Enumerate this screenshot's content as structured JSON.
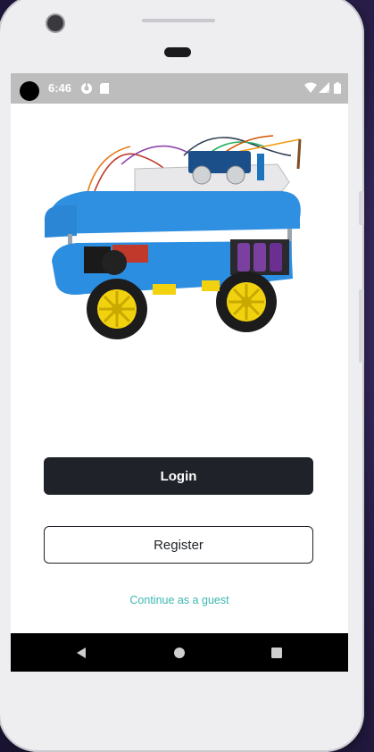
{
  "status_bar": {
    "time": "6:46",
    "left_icons": [
      "notification-icon",
      "sd-card-icon"
    ],
    "right_icons": [
      "wifi-icon",
      "signal-icon",
      "battery-icon"
    ]
  },
  "hero": {
    "image": "robot-car-image"
  },
  "actions": {
    "login_label": "Login",
    "register_label": "Register",
    "guest_label": "Continue as a guest"
  },
  "nav_bar": {
    "items": [
      "back-icon",
      "home-icon",
      "recents-icon"
    ]
  },
  "colors": {
    "primary": "#1f2229",
    "accent": "#3bb7b0",
    "status_bar": "#bdbdbd",
    "nav_bar": "#000000"
  }
}
